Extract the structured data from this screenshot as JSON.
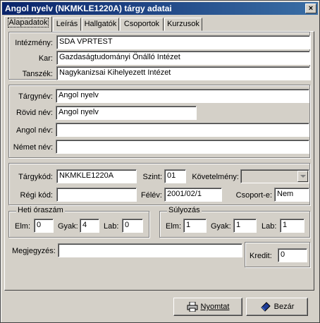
{
  "window": {
    "title": "Angol nyelv (NKMKLE1220A) tárgy adatai",
    "close_glyph": "×"
  },
  "tabs": [
    {
      "label": "Alapadatok"
    },
    {
      "label": "Leírás"
    },
    {
      "label": "Hallgatók"
    },
    {
      "label": "Csoportok"
    },
    {
      "label": "Kurzusok"
    }
  ],
  "org": {
    "institution_label": "Intézmény:",
    "institution_value": "SDA VPRTEST",
    "faculty_label": "Kar:",
    "faculty_value": "Gazdaságtudományi Önálló Intézet",
    "department_label": "Tanszék:",
    "department_value": "Nagykanizsai Kihelyezett Intézet"
  },
  "names": {
    "name_label": "Tárgynév:",
    "name_value": "Angol  nyelv",
    "short_label": "Rövid név:",
    "short_value": "Angol nyelv",
    "english_label": "Angol név:",
    "english_value": "",
    "german_label": "Német név:",
    "german_value": ""
  },
  "codes": {
    "code_label": "Tárgykód:",
    "code_value": "NKMKLE1220A",
    "level_label": "Szint:",
    "level_value": "01",
    "requirement_label": "Követelmény:",
    "requirement_value": "",
    "old_code_label": "Régi kód:",
    "old_code_value": "",
    "semester_label": "Félév:",
    "semester_value": "2001/02/1",
    "group_label": "Csoport-e:",
    "group_value": "Nem"
  },
  "weekly_hours": {
    "legend": "Heti óraszám",
    "lecture_label": "Elm:",
    "lecture_value": "0",
    "practice_label": "Gyak:",
    "practice_value": "4",
    "lab_label": "Lab:",
    "lab_value": "0"
  },
  "weighting": {
    "legend": "Súlyozás",
    "lecture_label": "Elm:",
    "lecture_value": "1",
    "practice_label": "Gyak:",
    "practice_value": "1",
    "lab_label": "Lab:",
    "lab_value": "1"
  },
  "notes": {
    "label": "Megjegyzés:",
    "value": ""
  },
  "credit": {
    "label": "Kredit:",
    "value": "0"
  },
  "buttons": {
    "print_label": "Nyomtat",
    "print_icon": "printer-icon",
    "close_label": "Bezár",
    "close_icon": "close-book-icon"
  }
}
